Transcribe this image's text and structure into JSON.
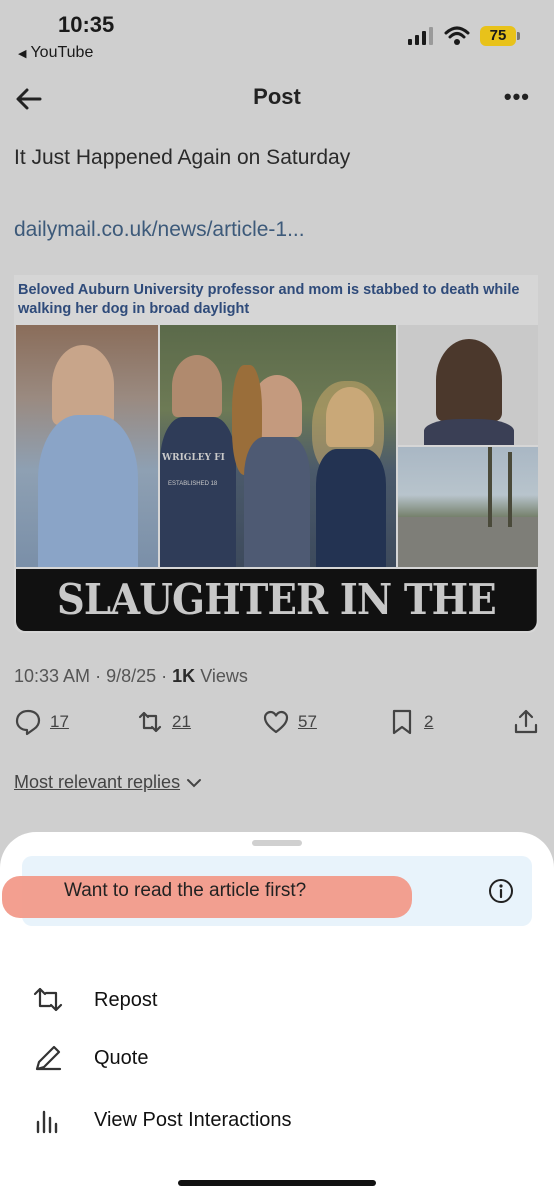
{
  "status_bar": {
    "time": "10:35",
    "back_app": "YouTube",
    "battery": "75"
  },
  "header": {
    "title": "Post",
    "more": "•••"
  },
  "post": {
    "text": "It Just Happened Again on Saturday",
    "link": "dailymail.co.uk/news/article-1...",
    "article": {
      "headline": "Beloved Auburn University professor and mom is stabbed to death while walking her dog in broad daylight",
      "banner": "SLAUGHTER IN THE SUN",
      "shirt_text": "WRIGLEY FI",
      "shirt_subtext": "ESTABLISHED 18"
    },
    "meta": {
      "time": "10:33 AM",
      "date": "9/8/25",
      "views_count": "1K",
      "views_label": "Views",
      "sep": "·"
    },
    "actions": {
      "replies": "17",
      "reposts": "21",
      "likes": "57",
      "bookmarks": "2"
    },
    "replies_filter": "Most relevant replies"
  },
  "sheet": {
    "prompt": "Want to read the article first?",
    "items": [
      {
        "label": "Repost",
        "icon": "repost-icon"
      },
      {
        "label": "Quote",
        "icon": "pen-icon"
      },
      {
        "label": "View Post Interactions",
        "icon": "bar-chart-icon"
      }
    ]
  },
  "colors": {
    "link": "#3d5a7a",
    "highlight": "#f29a8a",
    "prompt_bg": "#e8f3fb",
    "battery": "#e8c21a"
  }
}
